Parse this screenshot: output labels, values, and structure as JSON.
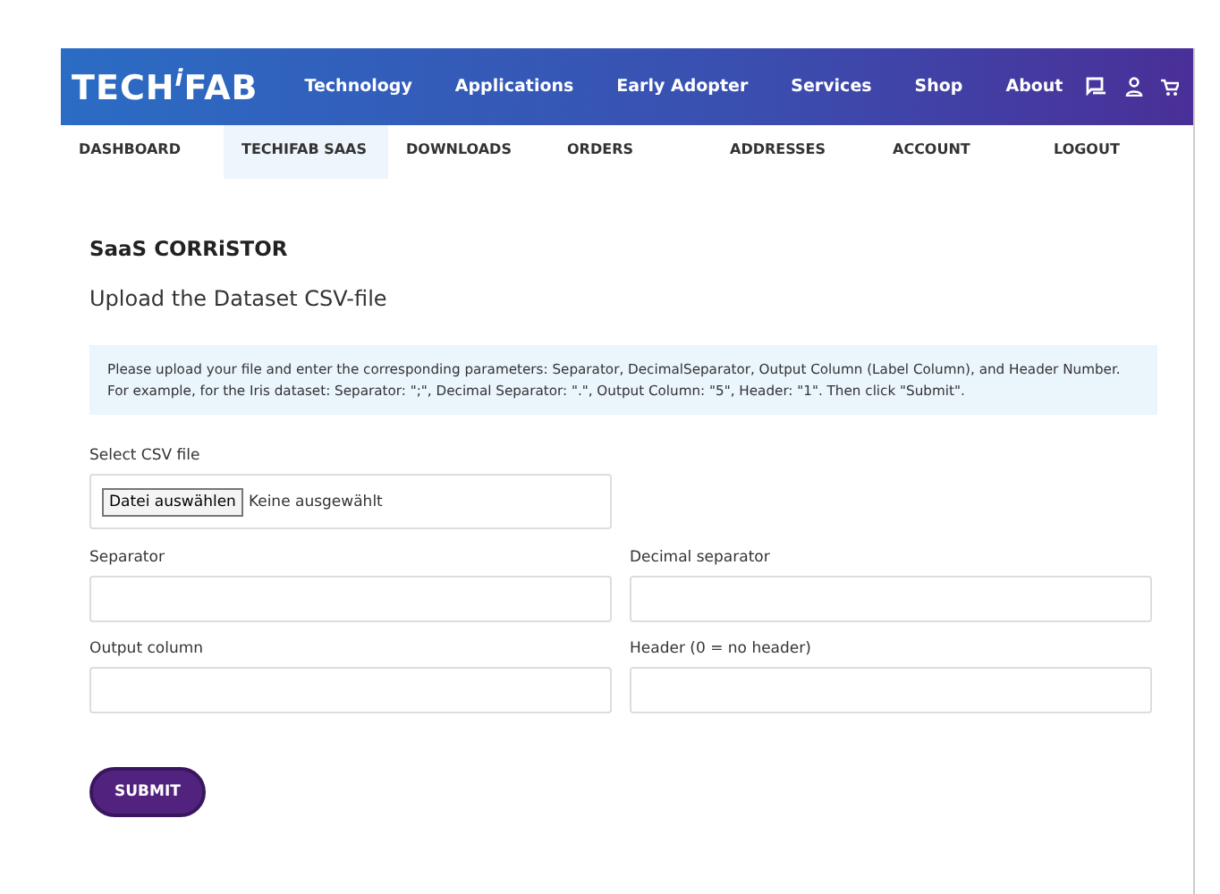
{
  "header": {
    "logo": "TECH$^{i}$FAB",
    "nav": [
      "Technology",
      "Applications",
      "Early Adopter",
      "Services",
      "Shop",
      "About"
    ]
  },
  "subnav": [
    {
      "label": "DASHBOARD",
      "selected": false
    },
    {
      "label": "TECHIFAB SAAS",
      "selected": true
    },
    {
      "label": "DOWNLOADS",
      "selected": false
    },
    {
      "label": "ORDERS",
      "selected": false
    },
    {
      "label": "ADDRESSES",
      "selected": false
    },
    {
      "label": "ACCOUNT",
      "selected": false
    },
    {
      "label": "LOGOUT",
      "selected": false
    }
  ],
  "title": "SaaS CORRiSTOR",
  "subtitle": "Upload the Dataset CSV-file",
  "info": "Please upload your file and enter the corresponding parameters: Separator, DecimalSeparator, Output Column (Label Column), and Header Number. For example, for the Iris dataset: Separator: \";\", Decimal Separator: \".\", Output Column: \"5\", Header: \"1\". Then click \"Submit\".",
  "file": {
    "label": "Select CSV file",
    "button": "Datei auswählen",
    "status": "Keine ausgewählt"
  },
  "fields": [
    {
      "label": "Separator"
    },
    {
      "label": "Decimal separator"
    },
    {
      "label": "Output column"
    },
    {
      "label": "Header (0 = no header)"
    }
  ],
  "submit": "SUBMIT"
}
